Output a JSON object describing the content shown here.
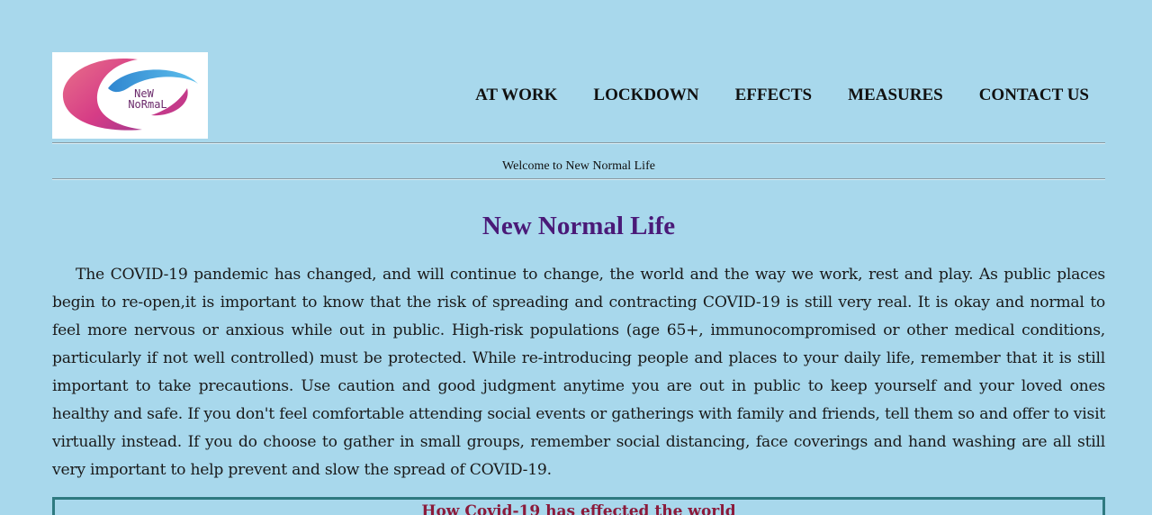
{
  "logo": {
    "text_line1": "NeW",
    "text_line2": "NoRmaL",
    "colors": {
      "ring_pink": "#d63c86",
      "ring_blue": "#4aa6e0",
      "text": "#6b2a6b"
    }
  },
  "nav": {
    "items": [
      {
        "label": "AT WORK"
      },
      {
        "label": "LOCKDOWN"
      },
      {
        "label": "EFFECTS"
      },
      {
        "label": "MEASURES"
      },
      {
        "label": "CONTACT US"
      }
    ]
  },
  "welcome_text": "Welcome to New Normal Life",
  "main": {
    "title": "New Normal Life",
    "intro": "The COVID-19 pandemic has changed, and will continue to change, the world and the way we work, rest and play. As public places begin to re-open,it is important to know that the risk of spreading and contracting COVID-19 is still very real. It is okay and normal to feel more nervous or anxious while out in public. High-risk populations (age 65+, immunocompromised or other medical conditions, particularly if not well controlled) must be protected. While re-introducing people and places to your daily life, remember that it is still important to take precautions. Use caution and good judgment anytime you are out in public to keep yourself and your loved ones healthy and safe. If you don't feel comfortable attending social events or gatherings with family and friends, tell them so and offer to visit virtually instead. If you do choose to gather in small groups, remember social distancing, face coverings and hand washing are all still very important to help prevent and slow the spread of COVID-19.",
    "effects_title": "How Covid-19 has effected the world"
  },
  "colors": {
    "background": "#a8d8ec",
    "heading": "#4a1a78",
    "effects_title": "#8b1a3a",
    "box_border": "#2e7a80"
  }
}
